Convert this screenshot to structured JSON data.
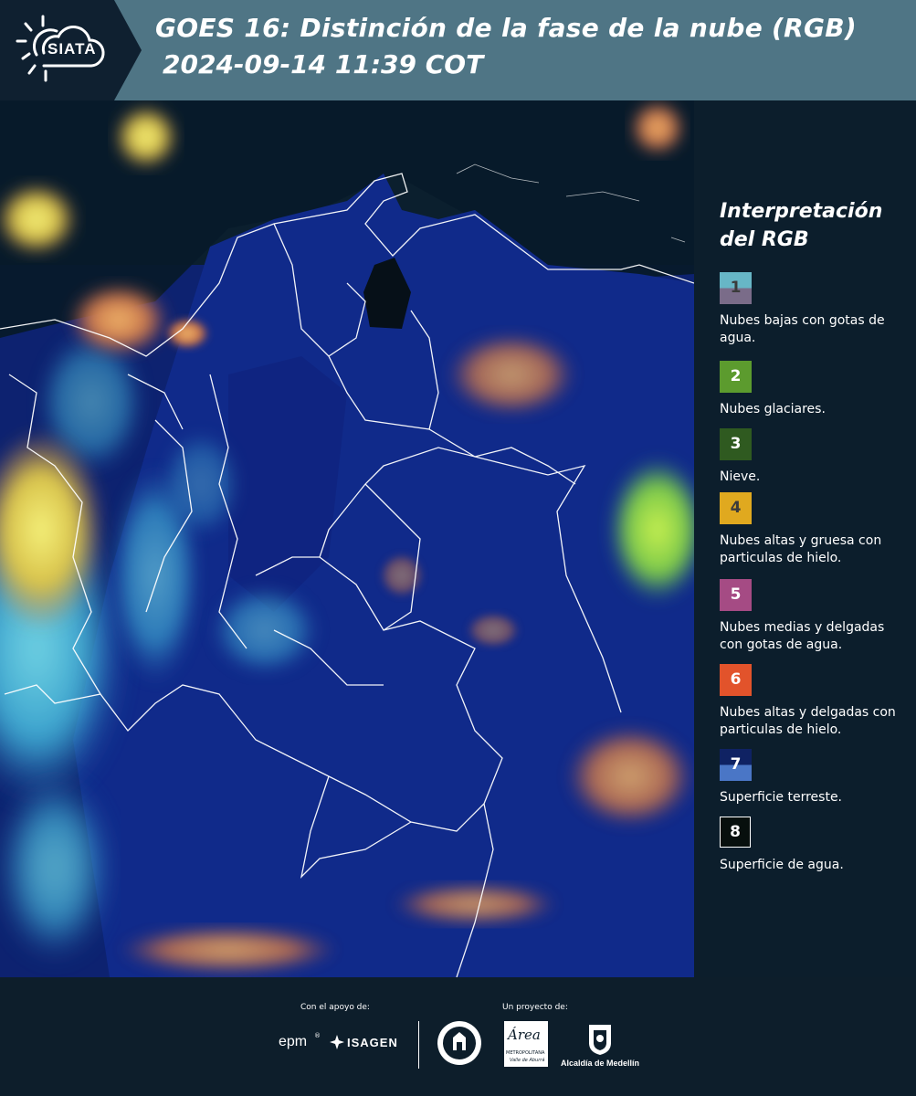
{
  "header": {
    "logo_text": "SIATA",
    "title_line1": "GOES 16: Distinción de la fase de la nube (RGB)",
    "title_line2": "2024-09-14 11:39 COT"
  },
  "legend": {
    "title_line1": "Interpretación",
    "title_line2": "del RGB",
    "items": [
      {
        "num": "1",
        "label": "Nubes bajas con gotas de agua.",
        "color_top": "#67b6c6",
        "color_bottom": "#7a6c89",
        "text_color": "#3b3b3b"
      },
      {
        "num": "2",
        "label": "Nubes glaciares.",
        "color": "#5c9b2e",
        "text_color": "#ffffff"
      },
      {
        "num": "3",
        "label": "Nieve.",
        "color": "#2f5a20",
        "text_color": "#ffffff"
      },
      {
        "num": "4",
        "label": "Nubes altas y gruesa con particulas de hielo.",
        "color": "#e0a91f",
        "text_color": "#3b3b3b"
      },
      {
        "num": "5",
        "label": "Nubes medias y delgadas con gotas de agua.",
        "color": "#a54b84",
        "text_color": "#ffffff"
      },
      {
        "num": "6",
        "label": "Nubes altas y delgadas con particulas de hielo.",
        "color": "#e2532b",
        "text_color": "#ffffff"
      },
      {
        "num": "7",
        "label": "Superficie terreste.",
        "color_top": "#0f2263",
        "color_bottom": "#4a76c6",
        "text_color": "#ffffff"
      },
      {
        "num": "8",
        "label": "Superficie de agua.",
        "color": "#070f0d",
        "text_color": "#ffffff",
        "border": "#ffffff"
      }
    ]
  },
  "footer": {
    "support_label": "Con el apoyo de:",
    "project_label": "Un proyecto de:",
    "brand_epm": "epm",
    "brand_isagen": "ISAGEN",
    "brand_area": "Área",
    "brand_area_sub1": "METROPOLITANA",
    "brand_area_sub2": "Valle de Aburrá",
    "brand_alcaldia": "Alcaldía de Medellín"
  }
}
